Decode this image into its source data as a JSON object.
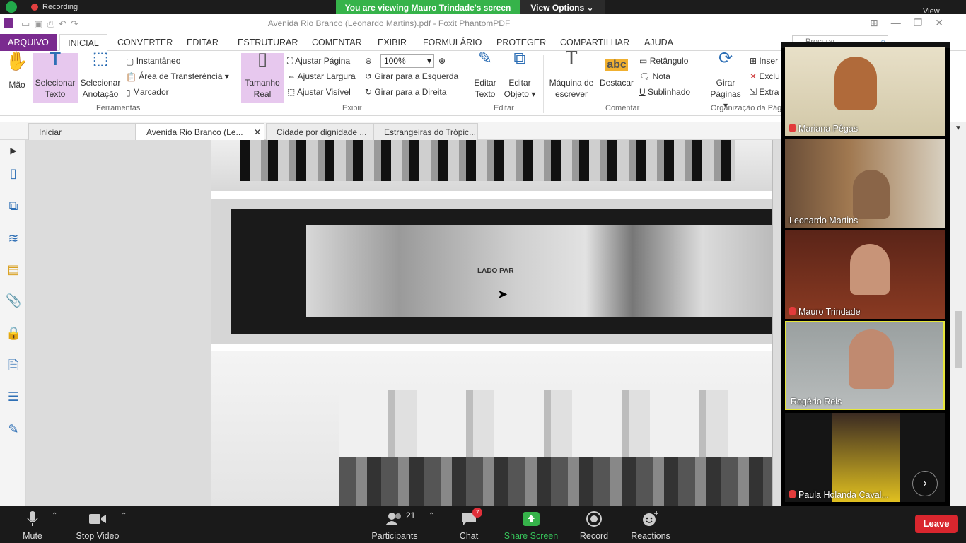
{
  "share_banner": {
    "recording_label": "Recording",
    "viewing_text": "You are viewing Mauro Trindade's screen",
    "view_options_label": "View Options",
    "view_label": "View"
  },
  "app": {
    "document_title": "Avenida Rio Branco (Leonardo Martins).pdf - Foxit PhantomPDF",
    "search_placeholder": "Procurar"
  },
  "menu": {
    "tabs": [
      "ARQUIVO",
      "INICIAL",
      "CONVERTER",
      "EDITAR",
      "ESTRUTURAR",
      "COMENTAR",
      "EXIBIR",
      "FORMULÁRIO",
      "PROTEGER",
      "COMPARTILHAR",
      "AJUDA"
    ],
    "active": "INICIAL"
  },
  "ribbon": {
    "hand_label": "Mão",
    "select_text": [
      "Selecionar",
      "Texto"
    ],
    "select_annotation": [
      "Selecionar",
      "Anotação"
    ],
    "snapshot": "Instantâneo",
    "clipboard": "Área de Transferência",
    "bookmark": "Marcador",
    "group_tools": "Ferramentas",
    "actual_size": [
      "Tamanho",
      "Real"
    ],
    "fit_page": "Ajustar Página",
    "fit_width": "Ajustar Largura",
    "fit_visible": "Ajustar Visível",
    "zoom_value": "100%",
    "rotate_left": "Girar para a Esquerda",
    "rotate_right": "Girar para a Direita",
    "group_view": "Exibir",
    "edit_text": [
      "Editar",
      "Texto"
    ],
    "edit_object": [
      "Editar",
      "Objeto"
    ],
    "group_edit": "Editar",
    "typewriter": [
      "Máquina de",
      "escrever"
    ],
    "highlight": "Destacar",
    "rectangle": "Retângulo",
    "note": "Nota",
    "underline": "Sublinhado",
    "group_comment": "Comentar",
    "rotate_pages": [
      "Girar",
      "Páginas"
    ],
    "insert": "Inser",
    "delete": "Exclu",
    "extract": "Extra",
    "group_pages": "Organização da Pági"
  },
  "doc_tabs": [
    "Iniciar",
    "Avenida Rio Branco (Le...",
    "Cidade por dignidade ...",
    "Estrangeiras do Trópic..."
  ],
  "doc_tab_active_index": 1,
  "page_image_text": "LADO PAR",
  "participants_gallery": [
    {
      "name": "Mariana Pêgas",
      "muted": true
    },
    {
      "name": "Leonardo Martins",
      "muted": false
    },
    {
      "name": "Mauro Trindade",
      "muted": true
    },
    {
      "name": "Rogério Reis",
      "muted": false,
      "speaking": true
    },
    {
      "name": "Paula Holanda Caval...",
      "muted": true
    }
  ],
  "zoom_toolbar": {
    "mute": "Mute",
    "stop_video": "Stop Video",
    "participants": "Participants",
    "participants_count": "21",
    "chat": "Chat",
    "chat_badge": "7",
    "share_screen": "Share Screen",
    "record": "Record",
    "reactions": "Reactions",
    "leave": "Leave"
  },
  "colors": {
    "foxit_purple": "#7a2b8f",
    "share_green": "#36b34a",
    "leave_red": "#d9262e",
    "active_speaker": "#e6e63a"
  }
}
